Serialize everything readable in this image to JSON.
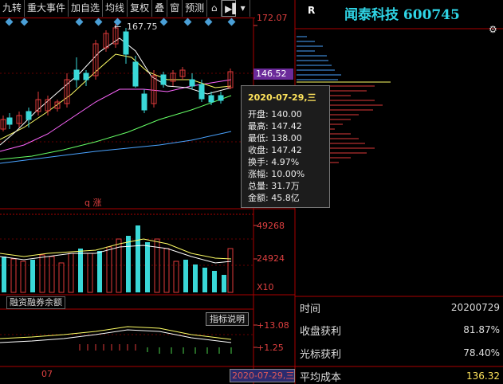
{
  "toolbar": {
    "items": [
      {
        "label": "九转"
      },
      {
        "label": "重大事件"
      },
      {
        "label": "加自选"
      },
      {
        "label": "均线"
      },
      {
        "label": "复权"
      },
      {
        "label": "叠"
      },
      {
        "label": "窗"
      },
      {
        "label": "预测"
      }
    ]
  },
  "stock": {
    "title": "闻泰科技 600745",
    "r_mark": "R"
  },
  "price_axis": {
    "top": "172.07",
    "current": "146.52",
    "hi_marker": "167.75",
    "q_label": "q 涨"
  },
  "volume_axis": {
    "v1": "49268",
    "v2": "24924",
    "unit": "X10"
  },
  "indicator": {
    "name": "融资融券余额",
    "explain_button": "指标说明",
    "v1": "+13.08",
    "v2": "+1.25"
  },
  "tooltip": {
    "date": "2020-07-29,三",
    "rows": [
      {
        "label": "开盘: 140.00"
      },
      {
        "label": "最高: 147.42"
      },
      {
        "label": "最低: 138.00"
      },
      {
        "label": "收盘: 147.42"
      },
      {
        "label": "换手: 4.97%"
      },
      {
        "label": "涨幅: 10.00%"
      },
      {
        "label": "总量: 31.7万"
      },
      {
        "label": "金额: 45.8亿"
      }
    ]
  },
  "info": {
    "time_label": "时间",
    "time_value": "20200729",
    "close_profit_label": "收盘获利",
    "close_profit_value": "81.87%",
    "cursor_profit_label": "光标获利",
    "cursor_profit_value": "78.40%",
    "avg_cost_label": "平均成本",
    "avg_cost_value": "136.32"
  },
  "bottom": {
    "month": "07",
    "date_tag": "2020-07-29,三"
  },
  "colors": {
    "up": "#e03a3a",
    "down": "#3ad8d8",
    "ma1": "#ffffff",
    "ma2": "#ffff66",
    "ma3": "#ff66ff",
    "ma4": "#66ff66",
    "ma5": "#4aa3ff"
  }
}
